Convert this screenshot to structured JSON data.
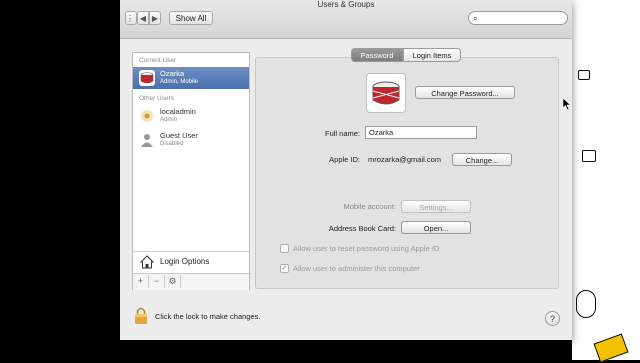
{
  "window": {
    "title": "Users & Groups"
  },
  "toolbar": {
    "show_all": "Show All",
    "search_placeholder": ""
  },
  "sidebar": {
    "current_user_label": "Current User",
    "current_user": {
      "name": "Ozarka",
      "role": "Admin, Mobile"
    },
    "other_users_label": "Other Users",
    "other_users": [
      {
        "name": "localadmin",
        "role": "Admin"
      },
      {
        "name": "Guest User",
        "role": "Disabled"
      }
    ],
    "login_options": "Login Options",
    "buttons": [
      "+",
      "−",
      "⚙"
    ]
  },
  "tabs": {
    "password": "Password",
    "login_items": "Login Items"
  },
  "main": {
    "change_password": "Change Password...",
    "full_name_label": "Full name:",
    "full_name_value": "Ozarka",
    "apple_id_label": "Apple ID:",
    "apple_id_value": "mrozarka@gmail.com",
    "apple_id_change": "Change...",
    "mobile_account_label": "Mobile account:",
    "mobile_account_button": "Settings...",
    "address_book_label": "Address Book Card:",
    "address_book_button": "Open...",
    "reset_password_check": "Allow user to reset password using Apple ID",
    "administer_check": "Allow user to administer this computer"
  },
  "footer": {
    "lock_text": "Click the lock to make changes.",
    "help": "?"
  }
}
